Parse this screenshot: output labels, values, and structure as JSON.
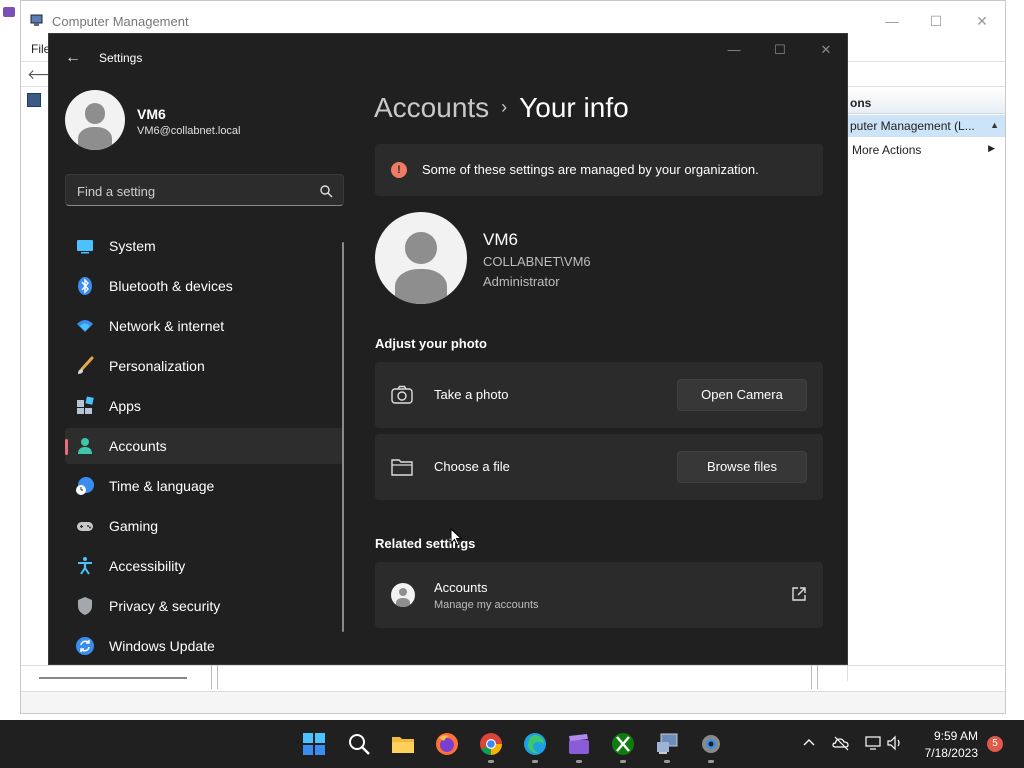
{
  "background_window": {
    "title": "Computer Management",
    "menu_first": "File",
    "actions_header": "ons",
    "actions_selected": "puter Management (L...",
    "actions_more": "More Actions"
  },
  "settings": {
    "app_title": "Settings",
    "profile": {
      "name": "VM6",
      "email": "VM6@collabnet.local"
    },
    "search_placeholder": "Find a setting",
    "nav": [
      {
        "label": "System",
        "icon": "system-icon"
      },
      {
        "label": "Bluetooth & devices",
        "icon": "bluetooth-icon"
      },
      {
        "label": "Network & internet",
        "icon": "wifi-icon"
      },
      {
        "label": "Personalization",
        "icon": "brush-icon"
      },
      {
        "label": "Apps",
        "icon": "apps-icon"
      },
      {
        "label": "Accounts",
        "icon": "accounts-icon",
        "active": true
      },
      {
        "label": "Time & language",
        "icon": "globe-clock-icon"
      },
      {
        "label": "Gaming",
        "icon": "controller-icon"
      },
      {
        "label": "Accessibility",
        "icon": "accessibility-icon"
      },
      {
        "label": "Privacy & security",
        "icon": "shield-icon"
      },
      {
        "label": "Windows Update",
        "icon": "update-icon"
      }
    ],
    "breadcrumb": {
      "parent": "Accounts",
      "separator": "›",
      "current": "Your info"
    },
    "banner": {
      "icon_glyph": "!",
      "text": "Some of these settings are managed by your organization."
    },
    "user": {
      "name": "VM6",
      "domain": "COLLABNET\\VM6",
      "role": "Administrator"
    },
    "adjust_photo": {
      "heading": "Adjust your photo",
      "take_photo": {
        "label": "Take a photo",
        "button": "Open Camera"
      },
      "choose_file": {
        "label": "Choose a file",
        "button": "Browse files"
      }
    },
    "related": {
      "heading": "Related settings",
      "accounts": {
        "title": "Accounts",
        "subtitle": "Manage my accounts"
      }
    }
  },
  "taskbar": {
    "pinned": [
      "start-icon",
      "search-icon",
      "file-explorer-icon",
      "firefox-icon",
      "chrome-icon",
      "edge-icon",
      "clapper-icon",
      "xbox-icon",
      "computer-management-icon",
      "settings-gear-icon"
    ],
    "time": "9:59 AM",
    "date": "7/18/2023",
    "notification_count": "5"
  },
  "colors": {
    "accent": "#e76f7d",
    "settings_bg": "#202020",
    "card_bg": "#2b2b2b",
    "warning": "#f07a63"
  }
}
